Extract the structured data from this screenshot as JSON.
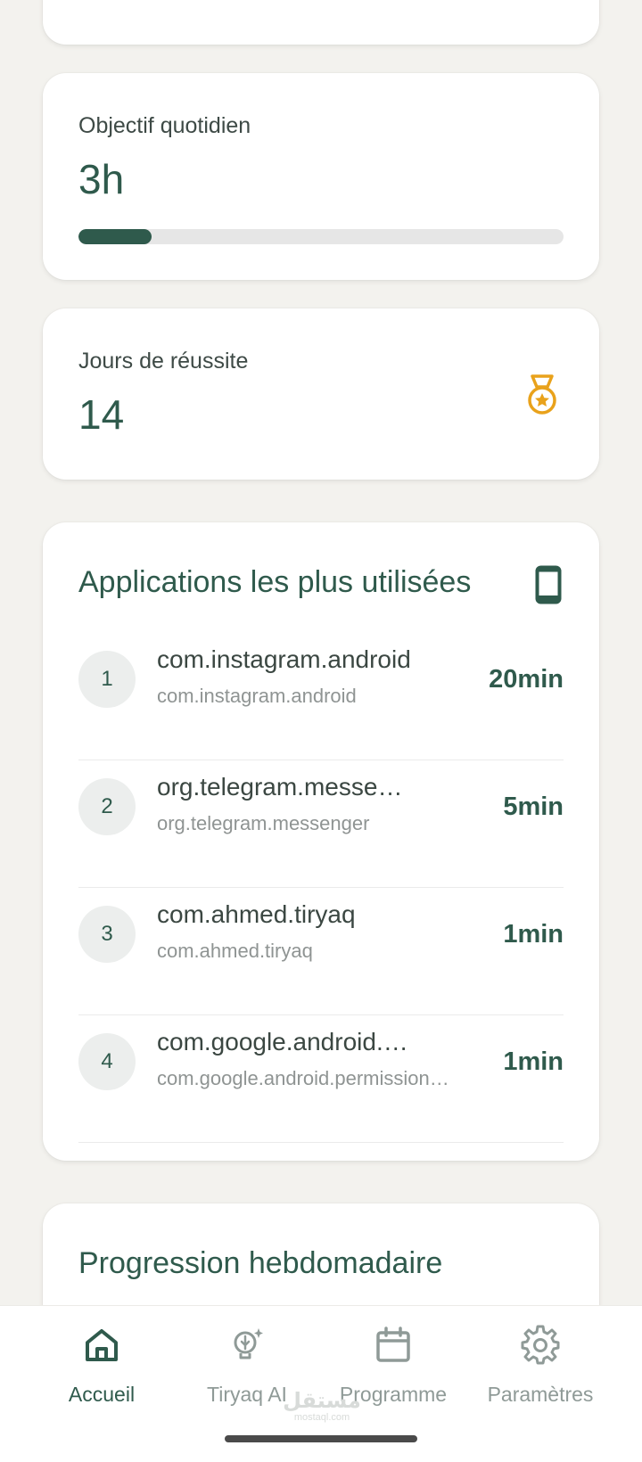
{
  "goal": {
    "label": "Objectif quotidien",
    "value": "3h",
    "progress_fraction": 0.15
  },
  "streak": {
    "label": "Jours de réussite",
    "value": "14",
    "icon": "medal-icon"
  },
  "apps": {
    "title": "Applications les plus utilisées",
    "icon": "phone-icon",
    "items": [
      {
        "rank": "1",
        "name": "com.instagram.android",
        "package": "com.instagram.android",
        "time": "20min"
      },
      {
        "rank": "2",
        "name": "org.telegram.messenger",
        "package": "org.telegram.messenger",
        "time": "5min"
      },
      {
        "rank": "3",
        "name": "com.ahmed.tiryaq",
        "package": "com.ahmed.tiryaq",
        "time": "1min"
      },
      {
        "rank": "4",
        "name": "com.google.android.per…",
        "package": "com.google.android.permission…",
        "time": "1min"
      }
    ]
  },
  "weekly": {
    "title": "Progression hebdomadaire"
  },
  "nav": {
    "items": [
      {
        "label": "Accueil",
        "icon": "home-icon",
        "active": true
      },
      {
        "label": "Tiryaq AI",
        "icon": "ai-bulb-icon",
        "active": false
      },
      {
        "label": "Programme",
        "icon": "calendar-icon",
        "active": false
      },
      {
        "label": "Paramètres",
        "icon": "gear-icon",
        "active": false
      }
    ]
  },
  "watermark": {
    "text": "مستقل",
    "sub": "mostaql.com"
  },
  "colors": {
    "primary": "#2f5a4c",
    "accent": "#e9a21b",
    "background": "#f3f2ee",
    "track": "#e6e6e6"
  }
}
